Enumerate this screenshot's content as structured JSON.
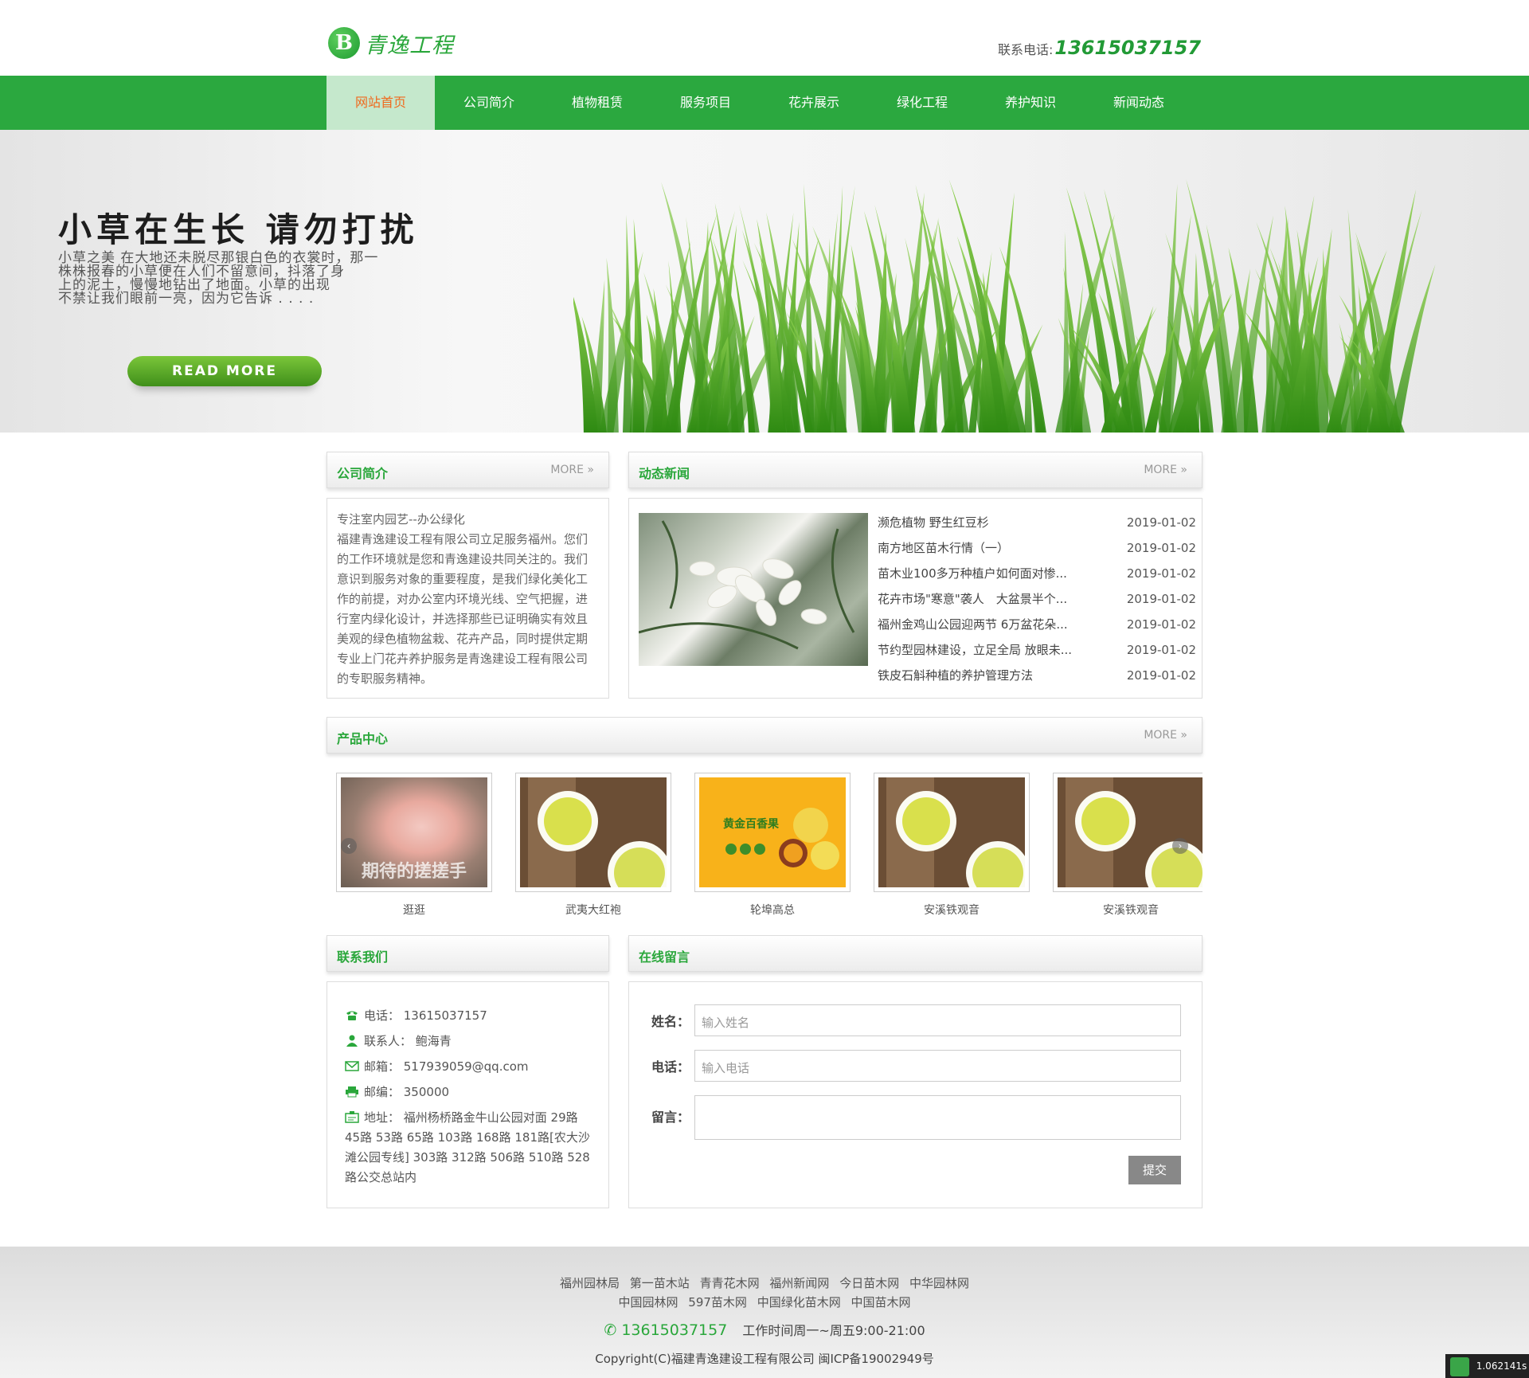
{
  "header": {
    "logo_text": "青逸工程",
    "logo_mark": "B",
    "phone_label": "联系电话:",
    "phone_number": "13615037157"
  },
  "nav": [
    "网站首页",
    "公司简介",
    "植物租赁",
    "服务项目",
    "花卉展示",
    "绿化工程",
    "养护知识",
    "新闻动态"
  ],
  "banner": {
    "headline": "小草在生长  请勿打扰",
    "text_lines": [
      "小草之美  在大地还未脱尽那银白色的衣裳时，那一",
      "株株报春的小草便在人们不留意间，抖落了身",
      "上的泥土，慢慢地钻出了地面。小草的出现",
      "不禁让我们眼前一亮，因为它告诉 . . . ."
    ],
    "button": "READ MORE"
  },
  "about": {
    "title": "公司简介",
    "more": "MORE »",
    "text": "专注室内园艺--办公绿化\n福建青逸建设工程有限公司立足服务福州。您们的工作环境就是您和青逸建设共同关注的。我们意识到服务对象的重要程度，是我们绿化美化工作的前提，对办公室内环境光线、空气把握，进行室内绿化设计，并选择那些已证明确实有效且美观的绿色植物盆栽、花卉产品，同时提供定期专业上门花卉养护服务是青逸建设工程有限公司的专职服务精神。"
  },
  "news": {
    "title": "动态新闻",
    "more": "MORE »",
    "items": [
      {
        "title": "濒危植物 野生红豆杉",
        "date": "2019-01-02"
      },
      {
        "title": "南方地区苗木行情（一）",
        "date": "2019-01-02"
      },
      {
        "title": "苗木业100多万种植户如何面对惨...",
        "date": "2019-01-02"
      },
      {
        "title": "花卉市场\"寒意\"袭人　大盆景半个...",
        "date": "2019-01-02"
      },
      {
        "title": "福州金鸡山公园迎两节 6万盆花朵...",
        "date": "2019-01-02"
      },
      {
        "title": "节约型园林建设，立足全局 放眼未...",
        "date": "2019-01-02"
      },
      {
        "title": "铁皮石斛种植的养护管理方法",
        "date": "2019-01-02"
      }
    ]
  },
  "products": {
    "title": "产品中心",
    "more": "MORE »",
    "items": [
      {
        "caption": "逛逛",
        "overlay": "期待的搓搓手"
      },
      {
        "caption": "武夷大红袍"
      },
      {
        "caption": "轮埠高总",
        "overlay": "黄金百香果"
      },
      {
        "caption": "安溪铁观音"
      },
      {
        "caption": "安溪铁观音"
      }
    ]
  },
  "contact": {
    "title": "联系我们",
    "rows": [
      {
        "icon": "phone-icon",
        "text": "电话：  13615037157"
      },
      {
        "icon": "person-icon",
        "text": "联系人：  鲍海青"
      },
      {
        "icon": "mail-icon",
        "text": "邮箱：  517939059@qq.com"
      },
      {
        "icon": "printer-icon",
        "text": "邮编：  350000"
      },
      {
        "icon": "address-icon",
        "text": "地址：  福州杨桥路金牛山公园对面 29路 45路 53路 65路 103路 168路 181路[农大沙滩公园专线] 303路 312路 506路 510路 528路公交总站内"
      }
    ]
  },
  "message": {
    "title": "在线留言",
    "name_label": "姓名：",
    "name_placeholder": "输入姓名",
    "phone_label": "电话：",
    "phone_placeholder": "输入电话",
    "msg_label": "留言：",
    "submit": "提交"
  },
  "footer": {
    "links": [
      "福州园林局",
      "第一苗木站",
      "青青花木网",
      "福州新闻网",
      "今日苗木网",
      "中华园林网",
      "中国园林网",
      "597苗木网",
      "中国绿化苗木网",
      "中国苗木网"
    ],
    "phone": "13615037157",
    "hours": "工作时间周一~周五9:00-21:00",
    "copyright": "Copyright(C)福建青逸建设工程有限公司 闽ICP备19002949号"
  },
  "timer": "1.062141s",
  "colors": {
    "brand_green": "#2ba83f",
    "nav_active_bg": "#c5e8cc",
    "nav_active_text": "#f06a1e"
  }
}
